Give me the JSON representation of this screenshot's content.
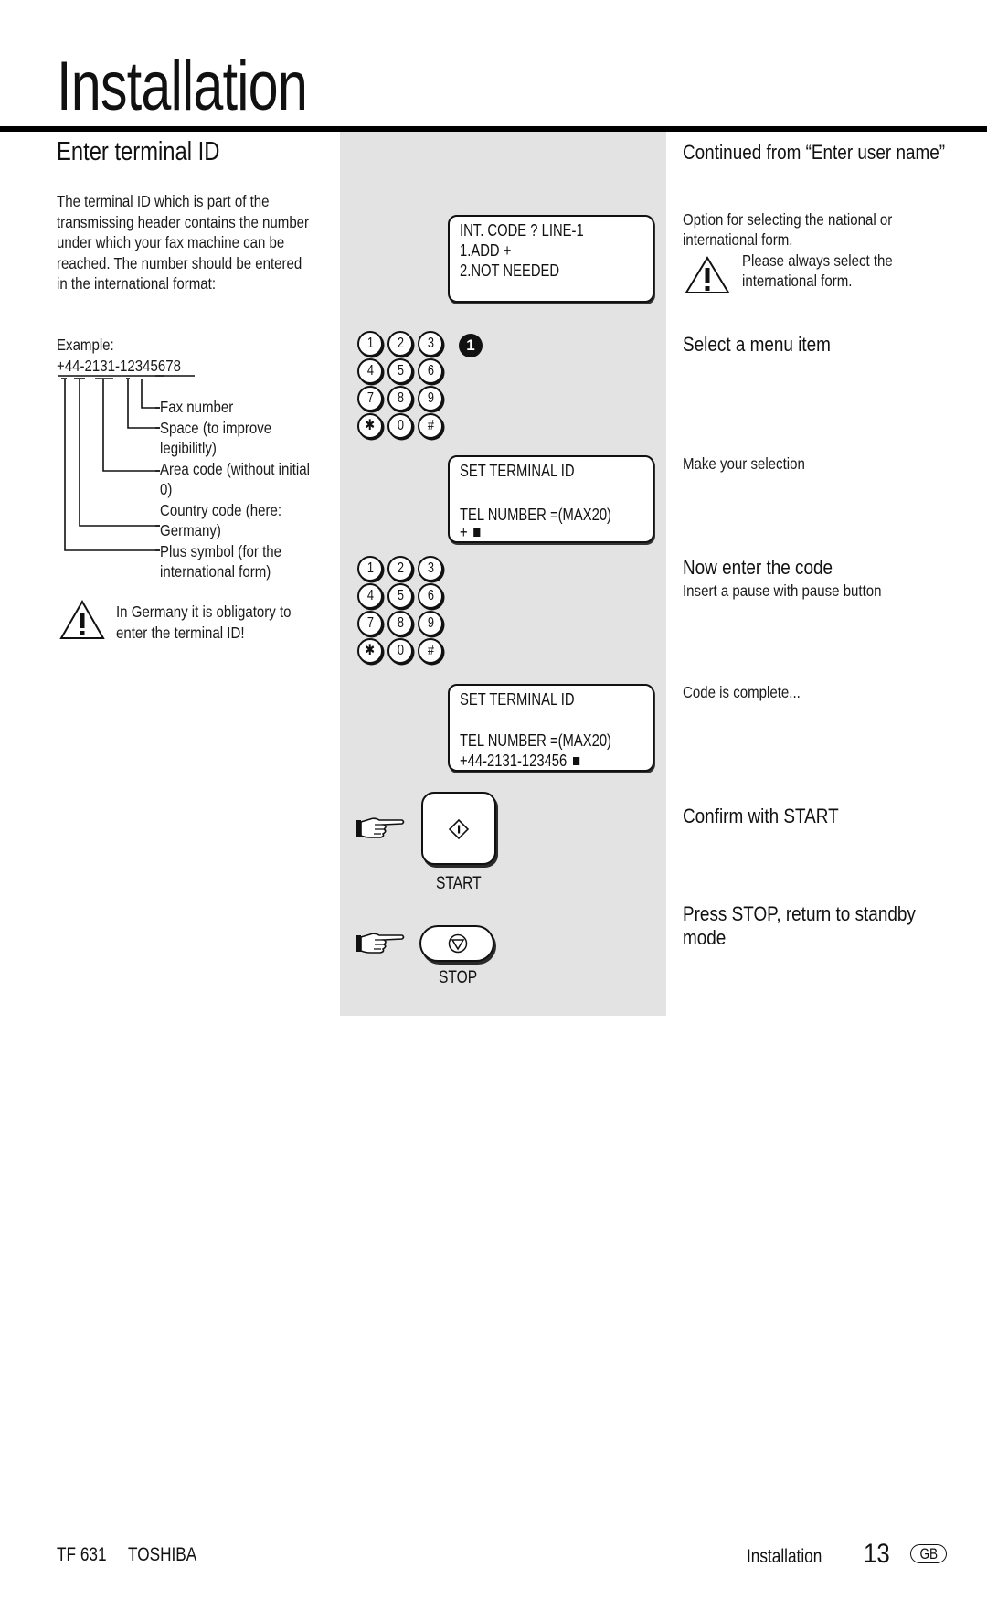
{
  "header": {
    "title": "Installation"
  },
  "left_column": {
    "section_title": "Enter terminal ID",
    "intro_lines": [
      "The terminal ID which is part of the",
      "transmissing header contains the number",
      "under which your fax machine can be",
      "reached. The number should be entered",
      "in the international format:"
    ],
    "example_label": "Example:",
    "example_number": "+44-2131-12345678",
    "legend": [
      "Fax number",
      "Space  (to improve",
      "legibilitly)",
      "Area code (without initial",
      "0)",
      "Country code (here:",
      "Germany)",
      "Plus symbol (for the",
      "international form)"
    ],
    "warning_lines": [
      "In Germany it is obligatory to",
      "enter the terminal ID!"
    ]
  },
  "center_panel": {
    "displays": [
      {
        "lines": [
          "INT. CODE ?   LINE-1",
          "1.ADD +",
          "2.NOT NEEDED"
        ]
      },
      {
        "lines": [
          "SET TERMINAL ID",
          "",
          "TEL NUMBER =(MAX20)",
          "+"
        ],
        "cursor": true
      },
      {
        "lines": [
          "SET TERMINAL ID",
          "",
          "TEL NUMBER =(MAX20)",
          "+44-2131-123456"
        ],
        "cursor": true
      }
    ],
    "keypad_keys": [
      "1",
      "2",
      "3",
      "4",
      "5",
      "6",
      "7",
      "8",
      "9",
      "✱",
      "0",
      "#"
    ],
    "step_badge": "1",
    "start_label": "START",
    "stop_label": "STOP"
  },
  "right_column": {
    "continued": "Continued from “Enter user name”",
    "option_lines": [
      "Option for selecting the national or",
      "international form."
    ],
    "warning_lines": [
      "Please always select the",
      "international form."
    ],
    "select_menu": "Select a menu item",
    "make_selection": "Make your selection",
    "enter_code": "Now enter the code",
    "pause_hint": "Insert a pause with pause button",
    "code_complete": "Code is complete...",
    "confirm_start": "Confirm with START",
    "press_stop_lines": [
      "Press STOP, return to standby",
      "mode"
    ]
  },
  "footer": {
    "model": "TF 631",
    "brand": "TOSHIBA",
    "section": "Installation",
    "page_number": "13",
    "country": "GB"
  }
}
